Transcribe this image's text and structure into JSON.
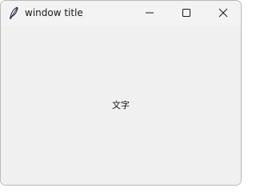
{
  "window": {
    "title": "window title"
  },
  "icons": {
    "app": "feather-icon",
    "minimize": "minimize-icon",
    "maximize": "maximize-icon",
    "close": "close-icon"
  },
  "content": {
    "label": "文字"
  },
  "colors": {
    "titlebar_bg": "#f3f3f3",
    "client_bg": "#f0f0f0",
    "text": "#1a1a1a"
  }
}
